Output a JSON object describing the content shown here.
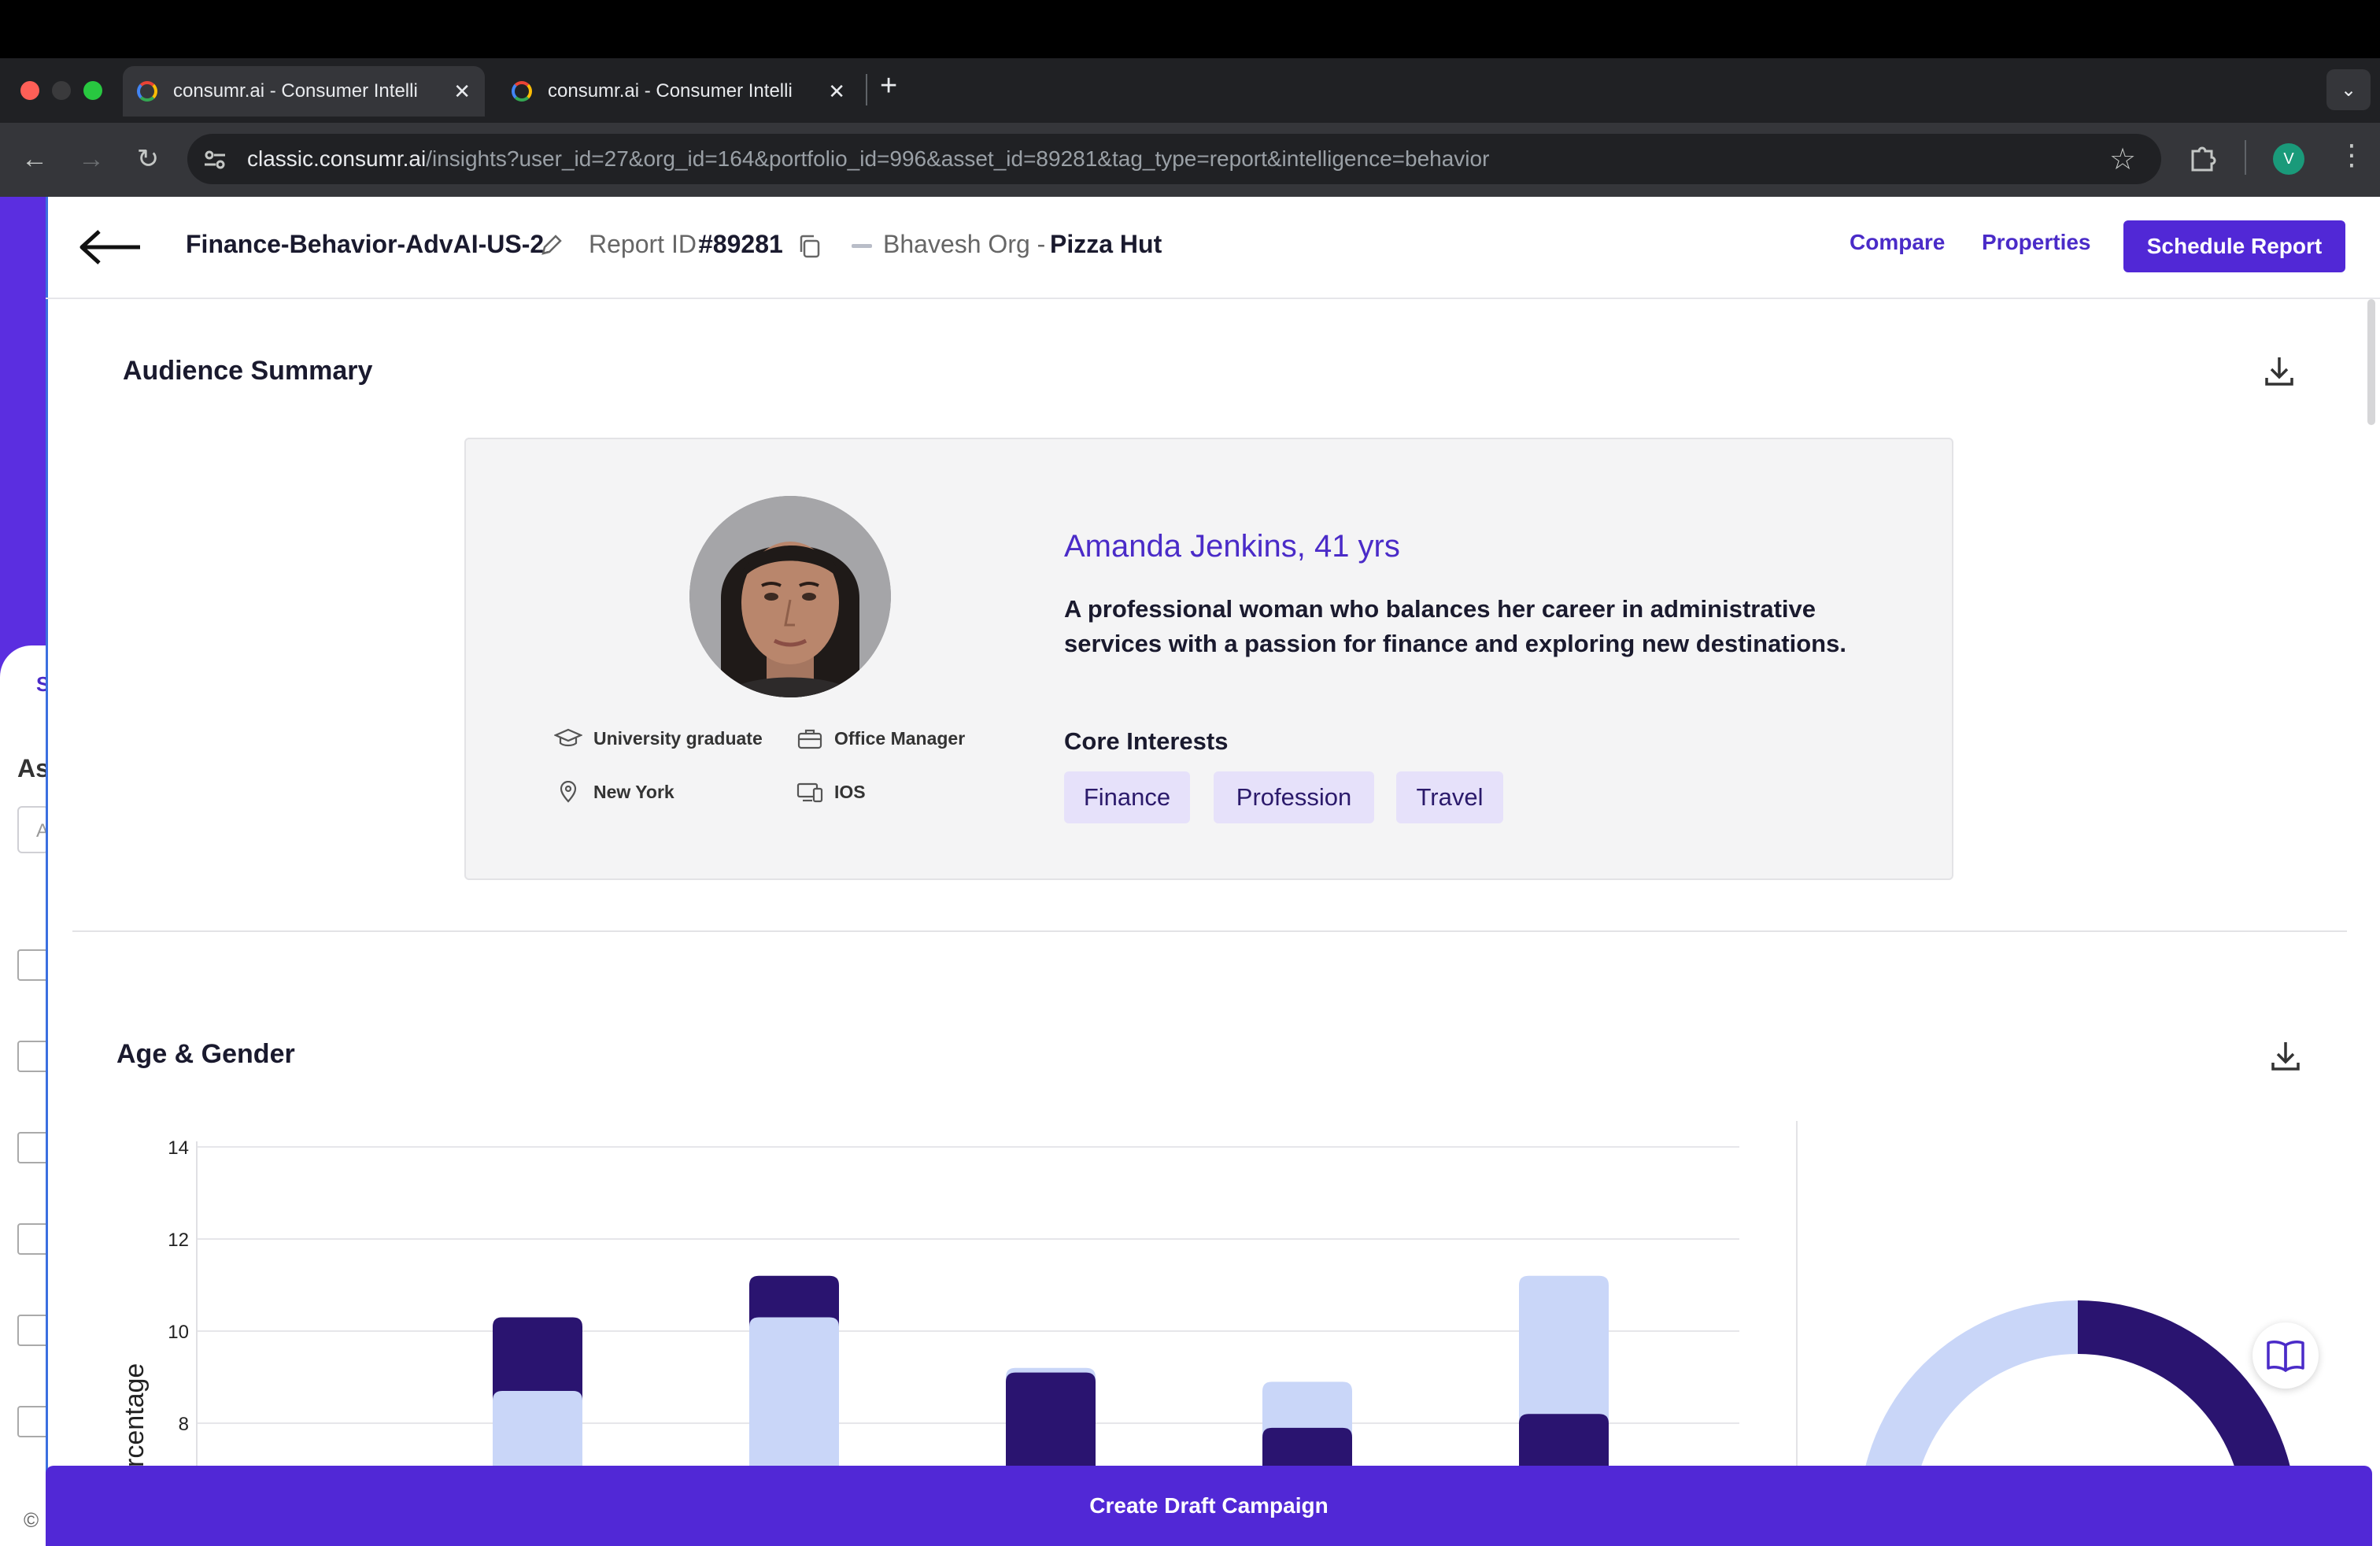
{
  "browser": {
    "tabs": [
      {
        "title": "consumr.ai - Consumer Intelli",
        "active": true
      },
      {
        "title": "consumr.ai - Consumer Intelli",
        "active": false
      }
    ],
    "new_tab": "+",
    "url_host": "classic.consumr.ai",
    "url_path": "/insights?user_id=27&org_id=164&portfolio_id=996&asset_id=89281&tag_type=report&intelligence=behavior",
    "profile_initial": "V"
  },
  "header": {
    "report_name": "Finance-Behavior-AdvAI-US-2",
    "report_id_label": "Report ID:",
    "report_id_value": "#89281",
    "org_label": "Bhavesh Org -",
    "brand": "Pizza Hut",
    "compare": "Compare",
    "properties": "Properties",
    "schedule": "Schedule Report"
  },
  "audience_summary": {
    "title": "Audience Summary",
    "persona_name": "Amanda Jenkins, 41 yrs",
    "description": "A professional woman who balances her career in administrative services with a passion for finance and exploring new destinations.",
    "education": "University graduate",
    "occupation": "Office Manager",
    "location": "New York",
    "device": "IOS",
    "core_interests_title": "Core Interests",
    "interests": [
      "Finance",
      "Profession",
      "Travel"
    ]
  },
  "age_gender": {
    "title": "Age & Gender"
  },
  "chart_data": {
    "type": "bar",
    "ylabel": "rcentage",
    "y_ticks": [
      8,
      10,
      12,
      14
    ],
    "stacks": [
      {
        "dark": 10.3,
        "light": 8.7
      },
      {
        "dark": 11.2,
        "light": 10.3
      },
      {
        "dark": 9.1,
        "light": 9.2
      },
      {
        "dark": 7.9,
        "light": 8.9
      },
      {
        "dark": 8.2,
        "light": 11.2
      }
    ],
    "colors": {
      "dark": "#2a1470",
      "light": "#c9d6f8"
    },
    "donut_dark_fraction": 0.5
  },
  "footer": {
    "cta": "Create Draft Campaign"
  },
  "leftpanel": {
    "letter_s": "S",
    "letter_as": "As",
    "letter_a": "A",
    "copyright": "©"
  }
}
